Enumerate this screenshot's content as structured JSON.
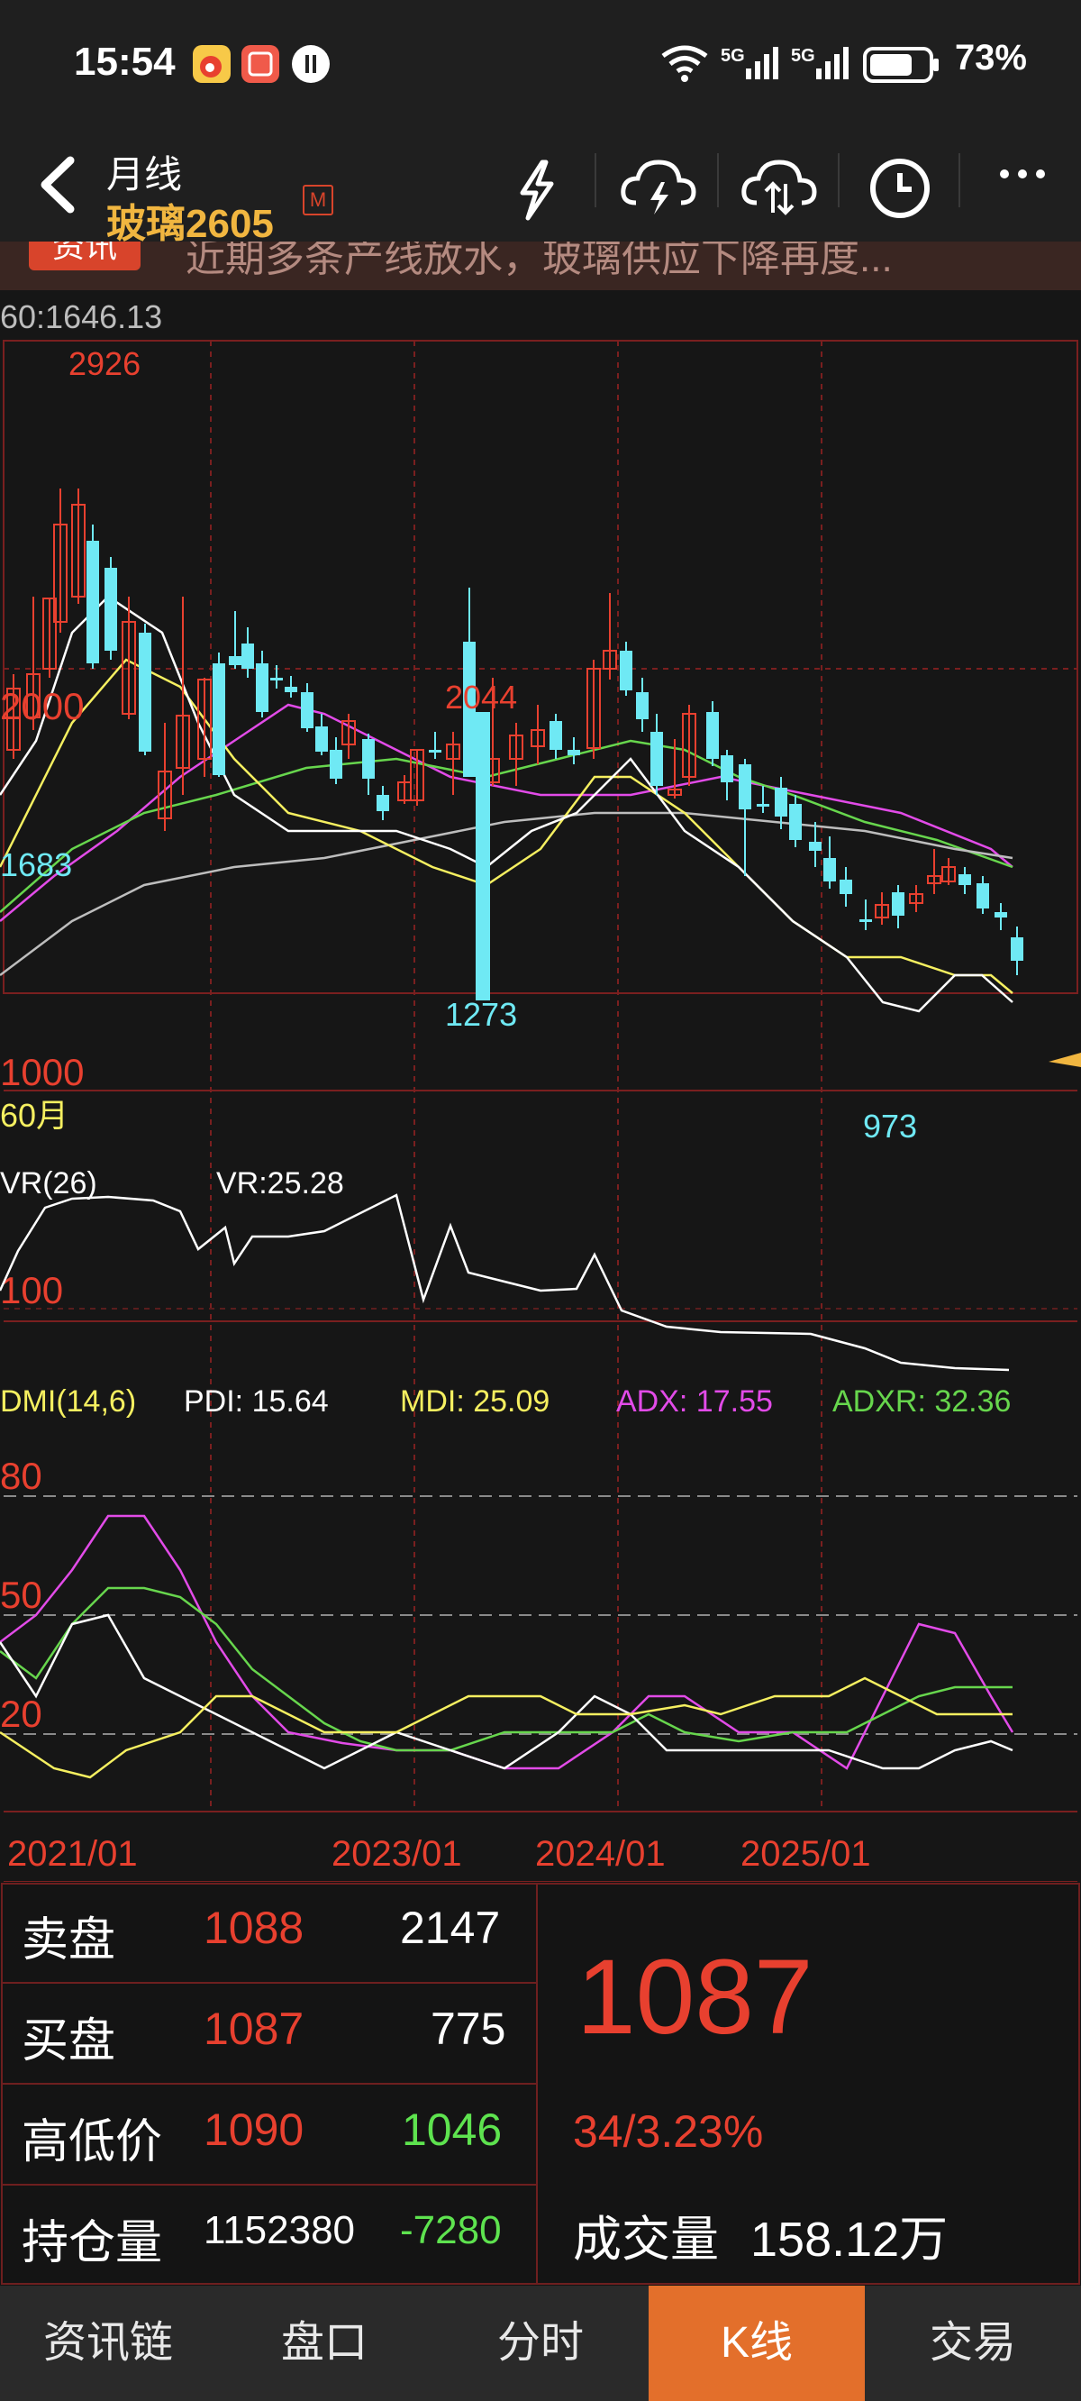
{
  "status": {
    "time": "15:54",
    "right_text": "73%",
    "icons": [
      "weibo-icon",
      "app-icon",
      "dark-app-icon",
      "nfc-icon",
      "wifi-icon",
      "signal-5g-icon",
      "battery-icon"
    ]
  },
  "header": {
    "back_icon": "chevron-left-icon",
    "period": "月线",
    "contract": "玻璃2605",
    "badge": "M",
    "actions": [
      "lightning-icon",
      "cloud-lightning-icon",
      "cloud-sync-icon",
      "clock-icon",
      "more-icon"
    ]
  },
  "news": {
    "tag": "资讯",
    "text": "近期多条产线放水，玻璃供应下降再度..."
  },
  "chart": {
    "top_readout": "60:1646.13",
    "labels": {
      "high": "2926",
      "mid_high": "2044",
      "left_2000": "2000",
      "left_1683": "1683",
      "low_1273": "1273",
      "left_1000": "1000",
      "low_973": "973",
      "period_60": "60月"
    },
    "vr": {
      "label": "VR(26)",
      "value_label": "VR:25.28",
      "level_100": "100"
    },
    "dmi": {
      "label": "DMI(14,6)",
      "pdi": "PDI: 15.64",
      "mdi": "MDI: 25.09",
      "adx": "ADX: 17.55",
      "adxr": "ADXR: 32.36",
      "levels": [
        "80",
        "50",
        "20"
      ]
    },
    "x_labels": [
      "2021/01",
      "2023/01",
      "2024/01",
      "2025/01"
    ],
    "colors": {
      "up": "#e8402f",
      "down": "#6fe9f4",
      "ma5": "#ffffff",
      "ma10": "#f5ef60",
      "ma20": "#e24be8",
      "ma40": "#67d64d",
      "ma60": "#bdbdbd"
    }
  },
  "quote": {
    "sell": {
      "label": "卖盘",
      "price": "1088",
      "volume": "2147"
    },
    "buy": {
      "label": "买盘",
      "price": "1087",
      "volume": "775"
    },
    "high_low": {
      "label": "高低价",
      "high": "1090",
      "low": "1046"
    },
    "open_interest": {
      "label": "持仓量",
      "value": "1152380",
      "change": "-7280"
    },
    "last_price": "1087",
    "change": "34/3.23%",
    "volume_label": "成交量",
    "volume_value": "158.12万"
  },
  "nav": {
    "tabs": [
      "资讯链",
      "盘口",
      "分时",
      "K线",
      "交易"
    ],
    "active": "K线"
  }
}
